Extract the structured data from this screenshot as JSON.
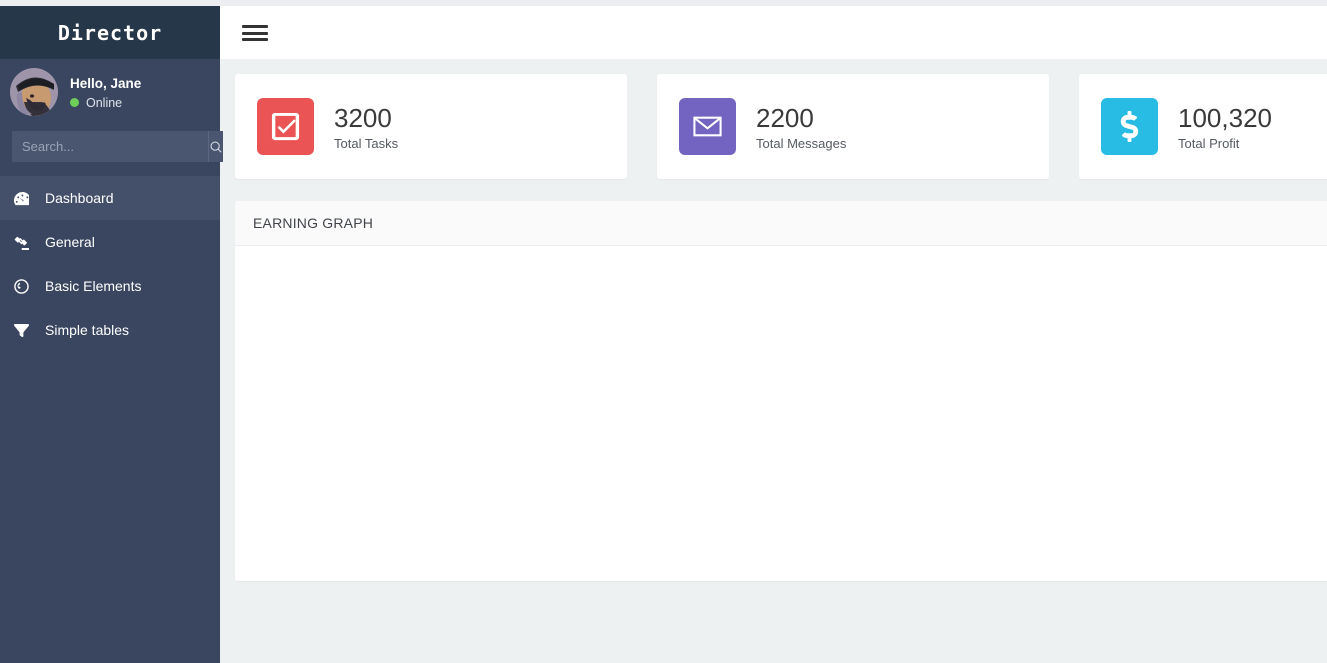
{
  "sidebar": {
    "brand": "Director",
    "user": {
      "greeting": "Hello, Jane",
      "status": "Online",
      "status_color": "#6fce5a",
      "avatar_icon": "user-portrait-avatar"
    },
    "search": {
      "placeholder": "Search...",
      "value": "",
      "button_icon": "search-icon"
    },
    "items": [
      {
        "label": "Dashboard",
        "icon": "tachometer-icon",
        "active": true
      },
      {
        "label": "General",
        "icon": "gavel-icon",
        "active": false
      },
      {
        "label": "Basic Elements",
        "icon": "globe-icon",
        "active": false
      },
      {
        "label": "Simple tables",
        "icon": "filter-icon",
        "active": false
      }
    ]
  },
  "topbar": {
    "menu_toggle_icon": "hamburger-menu-icon"
  },
  "main": {
    "stat_cards": [
      {
        "value": "3200",
        "label": "Total Tasks",
        "icon": "check-square-icon",
        "color": "#ea5455"
      },
      {
        "value": "2200",
        "label": "Total Messages",
        "icon": "envelope-icon",
        "color": "#7264c0"
      },
      {
        "value": "100,320",
        "label": "Total Profit",
        "icon": "dollar-sign-icon",
        "color": "#28bbe3"
      }
    ],
    "panel": {
      "title": "EARNING GRAPH",
      "body_text": ""
    }
  },
  "theme": {
    "sidebar_bg": "#3a4660",
    "sidebar_brand_bg": "#27374a",
    "sidebar_active_bg": "#44506a",
    "content_bg": "#edf1f2",
    "topbar_bg": "#ffffff",
    "panel_header_bg": "#fafafa"
  }
}
